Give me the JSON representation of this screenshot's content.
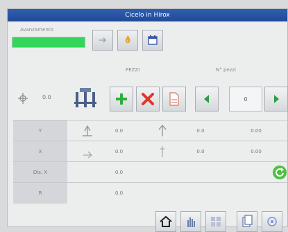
{
  "title": "Cicelo in Hirox",
  "progress": {
    "label": "Avanzamento",
    "percent": 100
  },
  "toolbar": {
    "icons": [
      "arrow-icon",
      "flame-icon",
      "calendar-icon"
    ]
  },
  "headers": {
    "pezzi": "PEZZI",
    "n_pezzi": "N° pezzi"
  },
  "left_readout": "0.0",
  "counter_value": "0",
  "rows": [
    {
      "label": "Y",
      "v1": "0.0",
      "v2": "0.0",
      "v3": "0.00"
    },
    {
      "label": "X",
      "v1": "0.0",
      "v2": "0.0",
      "v3": "0.00"
    },
    {
      "label": "Dis. X",
      "v1": "0.0"
    },
    {
      "label": "R",
      "v1": "0.0"
    }
  ],
  "colors": {
    "title_bg": "#1f4a98",
    "progress_green": "#33d65a"
  }
}
